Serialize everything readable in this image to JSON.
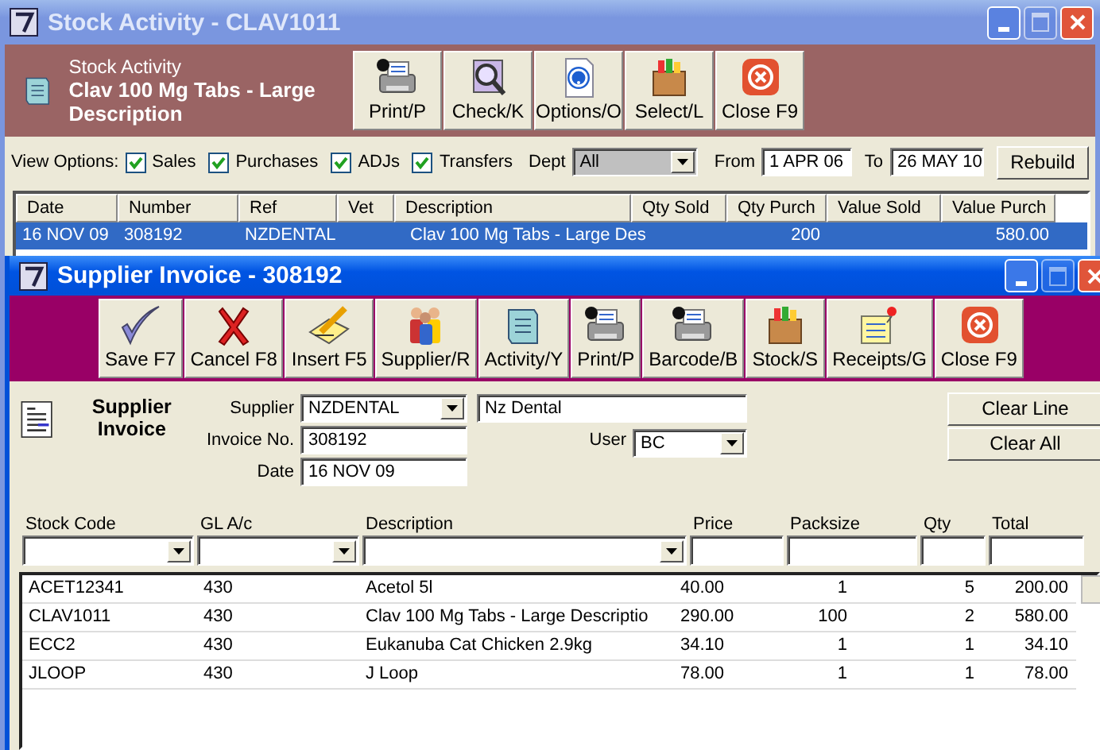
{
  "stock_activity_window": {
    "title": "Stock Activity - CLAV1011",
    "header": {
      "caption": "Stock Activity",
      "item": "Clav 100 Mg Tabs - Large Description"
    },
    "toolbar": [
      "Print/P",
      "Check/K",
      "Options/O",
      "Select/L",
      "Close F9"
    ],
    "view_options": {
      "label": "View Options:",
      "checks": [
        {
          "label": "Sales",
          "checked": true
        },
        {
          "label": "Purchases",
          "checked": true
        },
        {
          "label": "ADJs",
          "checked": true
        },
        {
          "label": "Transfers",
          "checked": true
        }
      ],
      "dept_label": "Dept",
      "dept": "All",
      "from_label": "From",
      "from": "1 APR 06",
      "to_label": "To",
      "to": "26 MAY 10",
      "rebuild": "Rebuild"
    },
    "table": {
      "columns": [
        "Date",
        "Number",
        "Ref",
        "Vet",
        "Description",
        "Qty Sold",
        "Qty Purch",
        "Value Sold",
        "Value Purch"
      ],
      "rows": [
        {
          "selected": true,
          "cells": [
            "16 NOV 09",
            "308192",
            "NZDENTAL",
            "",
            "Clav 100 Mg Tabs - Large Des",
            "",
            "200",
            "",
            "580.00"
          ]
        }
      ]
    }
  },
  "supplier_invoice_window": {
    "title": "Supplier Invoice - 308192",
    "toolbar": [
      "Save F7",
      "Cancel F8",
      "Insert F5",
      "Supplier/R",
      "Activity/Y",
      "Print/P",
      "Barcode/B",
      "Stock/S",
      "Receipts/G",
      "Close F9"
    ],
    "heading": "Supplier Invoice",
    "supplier_label": "Supplier",
    "supplier": "NZDENTAL",
    "supplier_name": "Nz Dental",
    "invoice_label": "Invoice No.",
    "invoice": "308192",
    "user_label": "User",
    "user": "BC",
    "date_label": "Date",
    "date": "16 NOV 09",
    "buttons": [
      "Clear Line",
      "Clear All"
    ],
    "lines": {
      "columns": [
        {
          "label": "Stock Code",
          "kind": "combo"
        },
        {
          "label": "GL A/c",
          "kind": "combo"
        },
        {
          "label": "Description",
          "kind": "combo"
        },
        {
          "label": "Price",
          "kind": "text"
        },
        {
          "label": "Packsize",
          "kind": "text"
        },
        {
          "label": "Qty",
          "kind": "text"
        },
        {
          "label": "Total",
          "kind": "text"
        }
      ],
      "rows": [
        [
          "ACET12341",
          "430",
          "Acetol 5l",
          "40.00",
          "1",
          "5",
          "200.00"
        ],
        [
          "CLAV1011",
          "430",
          "Clav 100 Mg Tabs - Large Descriptio",
          "290.00",
          "100",
          "2",
          "580.00"
        ],
        [
          "ECC2",
          "430",
          "Eukanuba Cat Chicken 2.9kg",
          "34.10",
          "1",
          "1",
          "34.10"
        ],
        [
          "JLOOP",
          "430",
          "J Loop",
          "78.00",
          "1",
          "1",
          "78.00"
        ]
      ]
    }
  }
}
